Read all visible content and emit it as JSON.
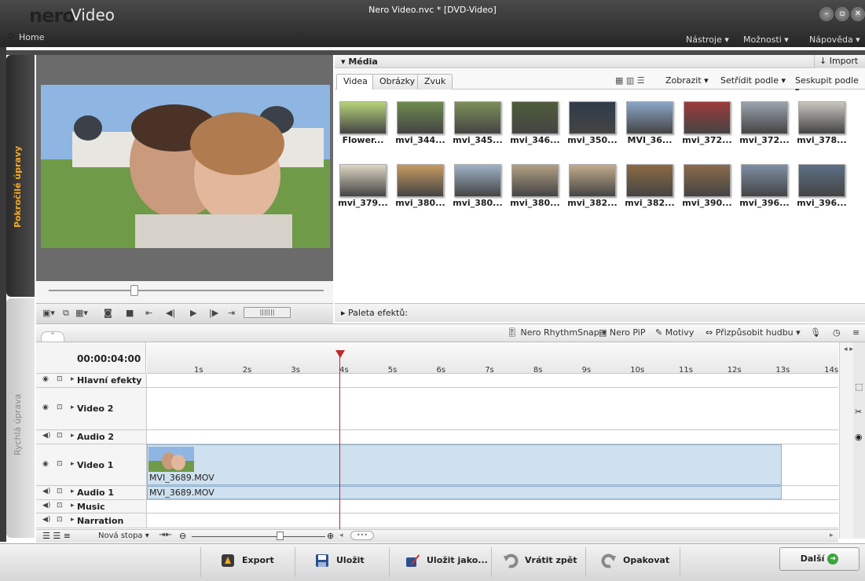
{
  "window": {
    "logo": "nero",
    "app_name": "Video",
    "title": "Nero Video.nvc * [DVD-Video]",
    "home": "Home",
    "menu": [
      "Nástroje ▾",
      "Možnosti ▾",
      "Nápověda ▾"
    ]
  },
  "side_tabs": {
    "advanced": "Pokročilé úpravy",
    "quick": "Rychlá úprava"
  },
  "media": {
    "title": "▾ Média",
    "import": "Import ▾",
    "tabs": [
      "Videa",
      "Obrázky",
      "Zvuk"
    ],
    "toolbar": {
      "show": "Zobrazit ▾",
      "sort": "Setřídit podle ▾",
      "group": "Seskupit podle ▾"
    },
    "items": [
      {
        "label": "Flower...",
        "color": "#b6d27a"
      },
      {
        "label": "mvi_344...",
        "color": "#6f8a4f"
      },
      {
        "label": "mvi_345...",
        "color": "#7c8f5a"
      },
      {
        "label": "mvi_346...",
        "color": "#4f5d3a"
      },
      {
        "label": "mvi_350...",
        "color": "#2f3c4a"
      },
      {
        "label": "MVI_36...",
        "color": "#8aa6c8"
      },
      {
        "label": "mvi_372...",
        "color": "#9d3a3a"
      },
      {
        "label": "mvi_372...",
        "color": "#9aa3ad"
      },
      {
        "label": "mvi_378...",
        "color": "#c9c6bf"
      },
      {
        "label": "mvi_379...",
        "color": "#ddd6c4"
      },
      {
        "label": "mvi_380...",
        "color": "#c59a60"
      },
      {
        "label": "mvi_380...",
        "color": "#9fb3c7"
      },
      {
        "label": "mvi_380...",
        "color": "#b39f84"
      },
      {
        "label": "mvi_382...",
        "color": "#c2ab8b"
      },
      {
        "label": "mvi_382...",
        "color": "#8c6a44"
      },
      {
        "label": "mvi_390...",
        "color": "#8b6a4a"
      },
      {
        "label": "mvi_396...",
        "color": "#7e8fa4"
      },
      {
        "label": "mvi_396...",
        "color": "#5c6f86"
      }
    ]
  },
  "effects_palette": "▸ Paleta efektů:",
  "timeline_toolbar": {
    "rhythm": "Nero RhythmSnap ▾",
    "pip": "Nero PiP",
    "themes": "Motivy",
    "fit_music": "Přizpůsobit hudbu ▾"
  },
  "timeline": {
    "timecode": "00:00:04:00",
    "ticks": [
      "1s",
      "2s",
      "3s",
      "4s",
      "5s",
      "6s",
      "7s",
      "8s",
      "9s",
      "10s",
      "11s",
      "12s",
      "13s",
      "14s"
    ],
    "tracks": [
      {
        "name": "Hlavní efekty",
        "kind": "video"
      },
      {
        "name": "Video 2",
        "kind": "video"
      },
      {
        "name": "Audio 2",
        "kind": "audio"
      },
      {
        "name": "Video 1",
        "kind": "video"
      },
      {
        "name": "Audio 1",
        "kind": "audio"
      },
      {
        "name": "Music",
        "kind": "audio"
      },
      {
        "name": "Narration",
        "kind": "audio"
      }
    ],
    "clip_video": "MVI_3689.MOV",
    "clip_audio": "MVI_3689.MOV",
    "new_track": "Nová stopa ▾"
  },
  "footer": {
    "export": "Export",
    "save": "Uložit",
    "save_as": "Uložit jako...",
    "undo": "Vrátit zpět",
    "redo": "Opakovat",
    "next": "Další"
  },
  "colors": {
    "accent_orange": "#f7a91f",
    "playhead": "#c0262a",
    "clip": "#cfe0ee"
  }
}
